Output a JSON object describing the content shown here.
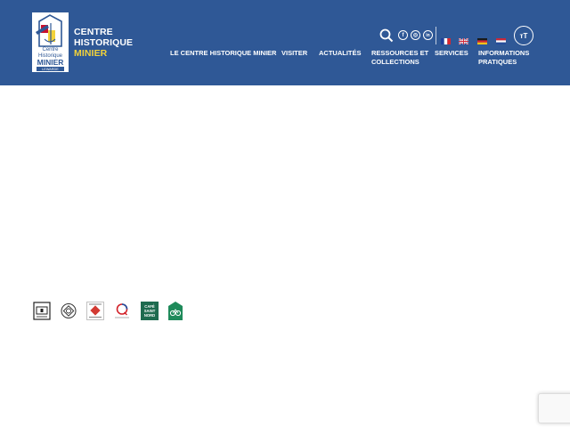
{
  "site": {
    "logo_text": [
      "Centre",
      "Historique",
      "MINIER",
      "LEWARDE"
    ],
    "name_line1": "CENTRE",
    "name_line2": "HISTORIQUE",
    "name_line3": "MINIER"
  },
  "nav": {
    "items": [
      {
        "line1": "LE CENTRE HISTORIQUE MINIER",
        "line2": ""
      },
      {
        "line1": "VISITER",
        "line2": ""
      },
      {
        "line1": "ACTUALITÉS",
        "line2": ""
      },
      {
        "line1": "RESSOURCES ET",
        "line2": "COLLECTIONS"
      },
      {
        "line1": "SERVICES",
        "line2": ""
      },
      {
        "line1": "INFORMATIONS",
        "line2": "PRATIQUES"
      }
    ]
  },
  "tools": {
    "search_icon": "search-icon",
    "social": [
      {
        "icon": "facebook-icon",
        "glyph": "f"
      },
      {
        "icon": "instagram-icon",
        "glyph": "◎"
      },
      {
        "icon": "linkedin-icon",
        "glyph": "in"
      }
    ],
    "languages": [
      "fr",
      "en",
      "de",
      "nl"
    ],
    "font_size_label": "тT"
  },
  "labels": {
    "icons": [
      "musee-de-france-label",
      "unesco-heritage-label",
      "monument-historique-label",
      "qualite-tourisme-label",
      "cafe-saint-nord-label",
      "accueil-velo-label"
    ],
    "cafe_text": [
      "CAFÉ",
      "SAINT",
      "NORD"
    ]
  },
  "colors": {
    "header": "#2f5896",
    "accent": "#f2d23b",
    "text_on_header": "#ffffff"
  }
}
